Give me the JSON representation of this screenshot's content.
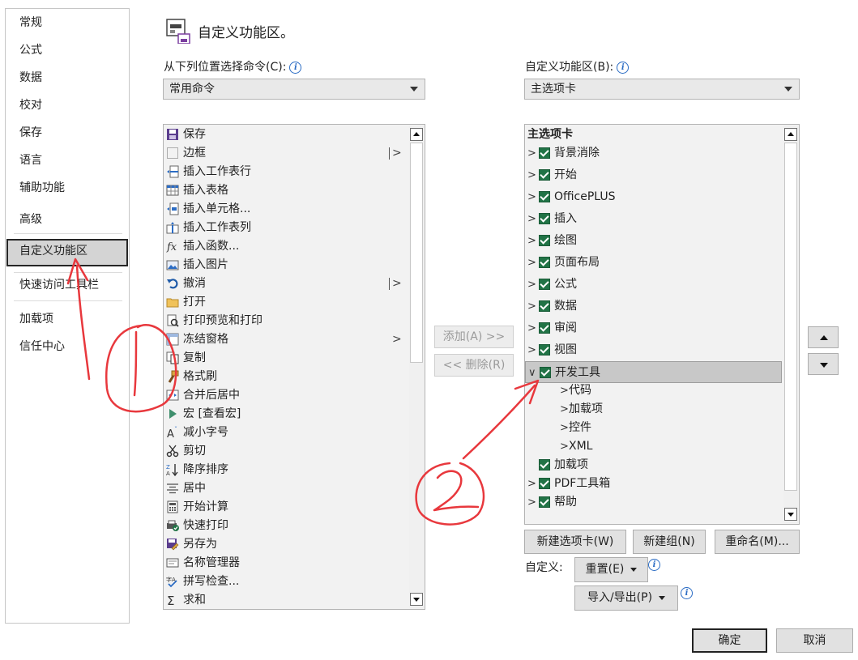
{
  "nav": {
    "items": [
      "常规",
      "公式",
      "数据",
      "校对",
      "保存",
      "语言",
      "辅助功能",
      "高级",
      "自定义功能区",
      "快速访问工具栏",
      "加载项",
      "信任中心"
    ],
    "selected": "自定义功能区"
  },
  "header": {
    "title": "自定义功能区。",
    "icon": "customize-ribbon-icon"
  },
  "left_panel": {
    "label": "从下列位置选择命令(C):",
    "combo_value": "常用命令",
    "commands": [
      {
        "label": "保存",
        "icon": "save-icon"
      },
      {
        "label": "边框",
        "icon": "border-icon",
        "submenu": "|>"
      },
      {
        "label": "插入工作表行",
        "icon": "insert-row-icon"
      },
      {
        "label": "插入表格",
        "icon": "table-icon"
      },
      {
        "label": "插入单元格...",
        "icon": "insert-cells-icon"
      },
      {
        "label": "插入工作表列",
        "icon": "insert-column-icon"
      },
      {
        "label": "插入函数...",
        "icon": "function-icon"
      },
      {
        "label": "插入图片",
        "icon": "picture-icon"
      },
      {
        "label": "撤消",
        "icon": "undo-icon",
        "submenu": "|>"
      },
      {
        "label": "打开",
        "icon": "folder-icon"
      },
      {
        "label": "打印预览和打印",
        "icon": "print-preview-icon"
      },
      {
        "label": "冻结窗格",
        "icon": "freeze-panes-icon",
        "submenu": ">"
      },
      {
        "label": "复制",
        "icon": "copy-icon"
      },
      {
        "label": "格式刷",
        "icon": "format-painter-icon"
      },
      {
        "label": "合并后居中",
        "icon": "merge-center-icon"
      },
      {
        "label": "宏 [查看宏]",
        "icon": "macro-icon"
      },
      {
        "label": "减小字号",
        "icon": "decrease-font-icon"
      },
      {
        "label": "剪切",
        "icon": "cut-icon"
      },
      {
        "label": "降序排序",
        "icon": "sort-descending-icon"
      },
      {
        "label": "居中",
        "icon": "center-align-icon"
      },
      {
        "label": "开始计算",
        "icon": "calculator-icon"
      },
      {
        "label": "快速打印",
        "icon": "quick-print-icon"
      },
      {
        "label": "另存为",
        "icon": "save-as-icon"
      },
      {
        "label": "名称管理器",
        "icon": "name-manager-icon"
      },
      {
        "label": "拼写检查...",
        "icon": "spell-check-icon"
      },
      {
        "label": "求和",
        "icon": "sum-icon"
      }
    ]
  },
  "middle": {
    "add_label": "添加(A) >>",
    "remove_label": "<< 删除(R)"
  },
  "right_panel": {
    "label": "自定义功能区(B):",
    "combo_value": "主选项卡",
    "tree_header": "主选项卡",
    "tabs": [
      {
        "label": "背景消除",
        "expander": ">",
        "checked": true
      },
      {
        "label": "开始",
        "expander": ">",
        "checked": true
      },
      {
        "label": "OfficePLUS",
        "expander": ">",
        "checked": true
      },
      {
        "label": "插入",
        "expander": ">",
        "checked": true
      },
      {
        "label": "绘图",
        "expander": ">",
        "checked": true
      },
      {
        "label": "页面布局",
        "expander": ">",
        "checked": true
      },
      {
        "label": "公式",
        "expander": ">",
        "checked": true
      },
      {
        "label": "数据",
        "expander": ">",
        "checked": true
      },
      {
        "label": "审阅",
        "expander": ">",
        "checked": true
      },
      {
        "label": "视图",
        "expander": ">",
        "checked": true
      },
      {
        "label": "开发工具",
        "expander": "v",
        "checked": true,
        "selected": true
      },
      {
        "label": "代码",
        "expander": ">",
        "group": true
      },
      {
        "label": "加载项",
        "expander": ">",
        "group": true
      },
      {
        "label": "控件",
        "expander": ">",
        "group": true
      },
      {
        "label": "XML",
        "expander": ">",
        "group": true
      },
      {
        "label": "加载项",
        "expander": "",
        "checked": true
      },
      {
        "label": "PDF工具箱",
        "expander": ">",
        "checked": true
      },
      {
        "label": "帮助",
        "expander": ">",
        "checked": true
      }
    ],
    "new_tab": "新建选项卡(W)",
    "new_group": "新建组(N)",
    "rename": "重命名(M)...",
    "customize_label": "自定义:",
    "reset": "重置(E)",
    "import_export": "导入/导出(P)"
  },
  "footer": {
    "ok": "确定",
    "cancel": "取消"
  },
  "annotations": {
    "color": "#e8383d"
  },
  "colors": {
    "check": "#217346",
    "info": "#2b6cc4"
  }
}
